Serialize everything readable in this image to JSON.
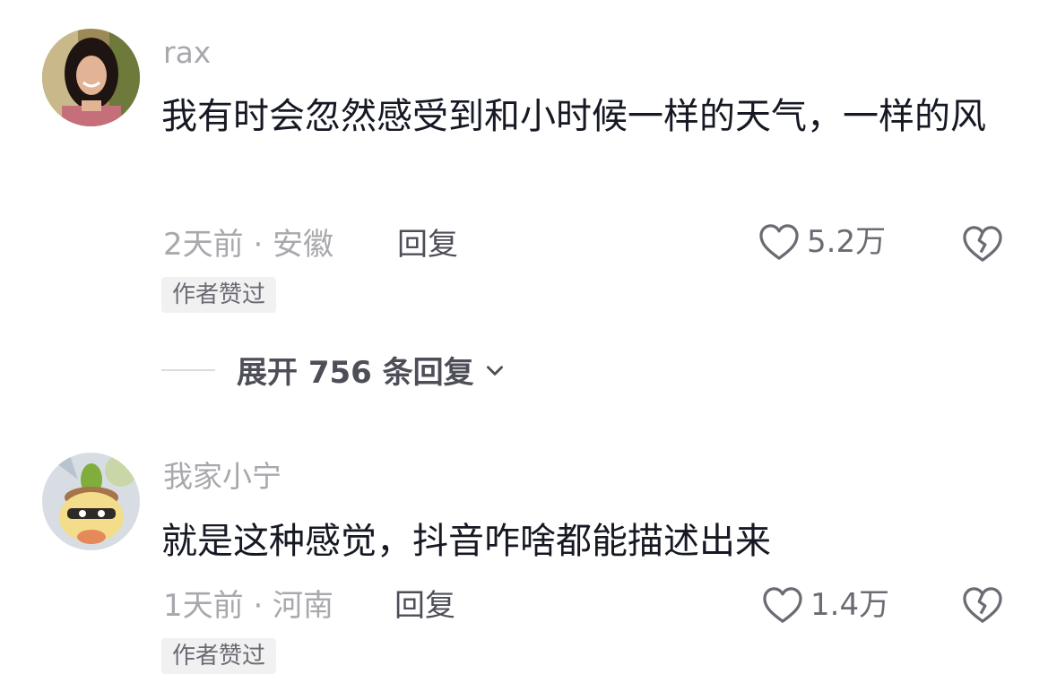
{
  "comments": [
    {
      "username": "rax",
      "text": "我有时会忽然感受到和小时候一样的天气，一样的风",
      "time_location": "2天前 · 安徽",
      "reply_label": "回复",
      "like_count": "5.2万",
      "badge": "作者赞过",
      "expand_label": "展开 756 条回复"
    },
    {
      "username": "我家小宁",
      "text": "就是这种感觉，抖音咋啥都能描述出来",
      "time_location": "1天前 · 河南",
      "reply_label": "回复",
      "like_count": "1.4万",
      "badge": "作者赞过"
    }
  ],
  "icons": {
    "like": "heart-outline-icon",
    "dislike": "broken-heart-icon",
    "expand": "chevron-down-icon"
  },
  "colors": {
    "text_primary": "#161823",
    "text_secondary": "#a8a8ad",
    "badge_bg": "#f1f1f2"
  }
}
